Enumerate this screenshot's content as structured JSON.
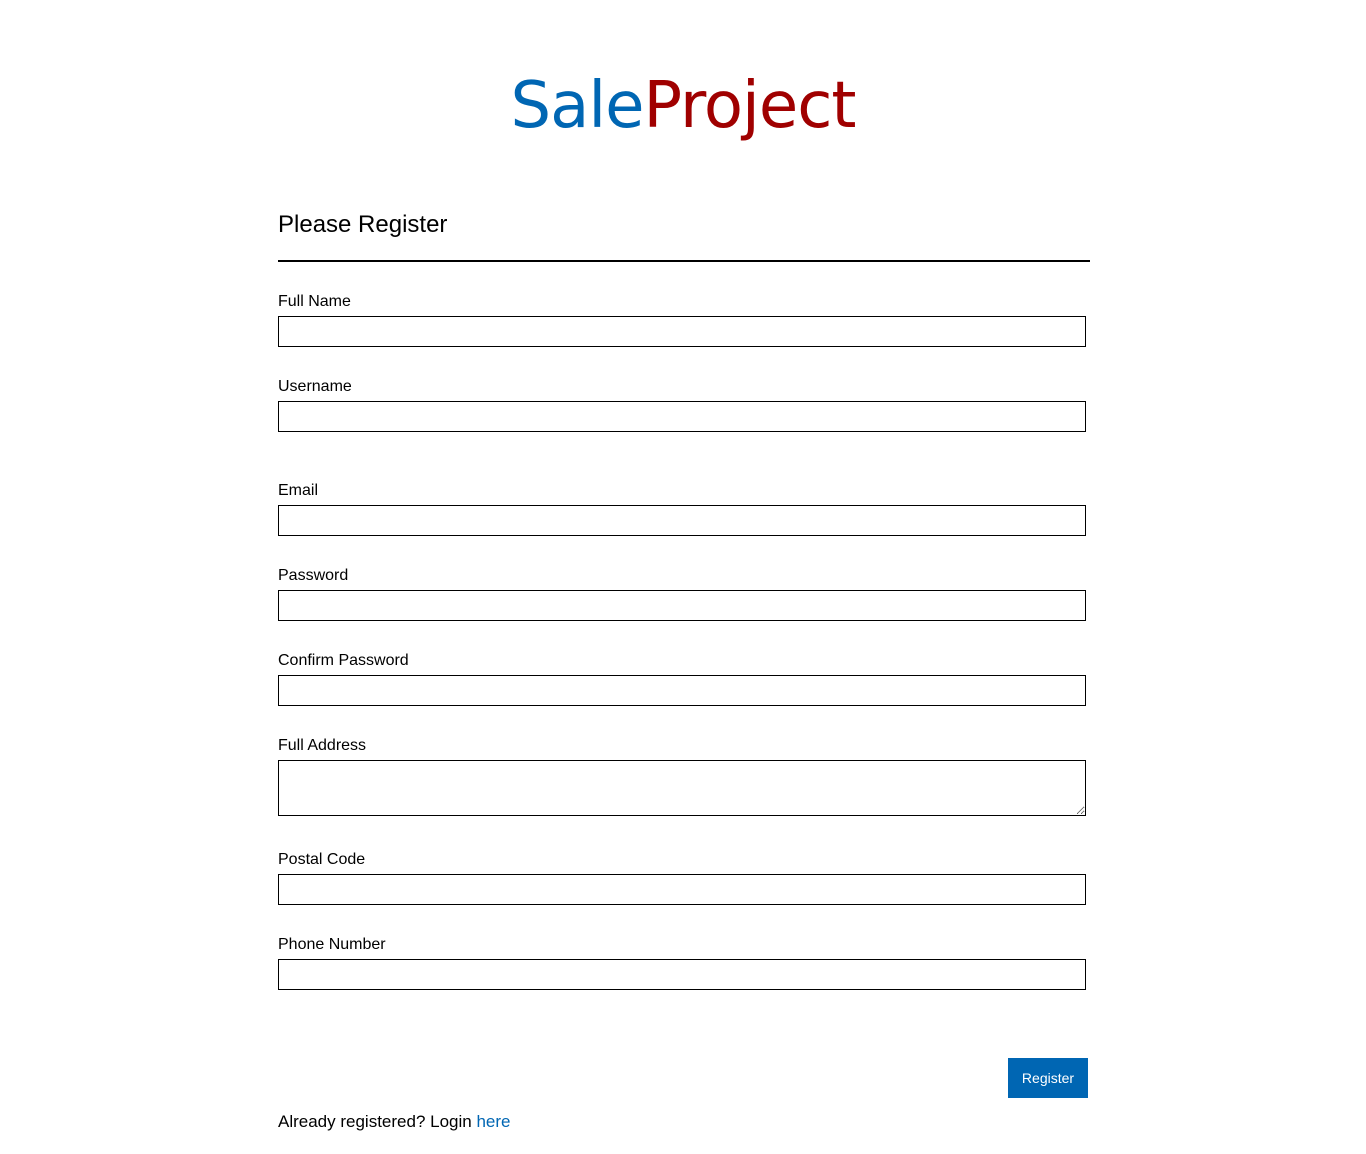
{
  "logo": {
    "part1": "Sale",
    "part2": "Project",
    "color1": "#0066b3",
    "color2": "#a00000"
  },
  "form": {
    "title": "Please Register",
    "fields": {
      "full_name": {
        "label": "Full Name",
        "value": ""
      },
      "username": {
        "label": "Username",
        "value": ""
      },
      "email": {
        "label": "Email",
        "value": ""
      },
      "password": {
        "label": "Password",
        "value": ""
      },
      "confirm_password": {
        "label": "Confirm Password",
        "value": ""
      },
      "full_address": {
        "label": "Full Address",
        "value": ""
      },
      "postal_code": {
        "label": "Postal Code",
        "value": ""
      },
      "phone_number": {
        "label": "Phone Number",
        "value": ""
      }
    },
    "submit_label": "Register",
    "accent_color": "#0066b3"
  },
  "footer": {
    "prompt": "Already registered? Login ",
    "link_text": "here"
  }
}
